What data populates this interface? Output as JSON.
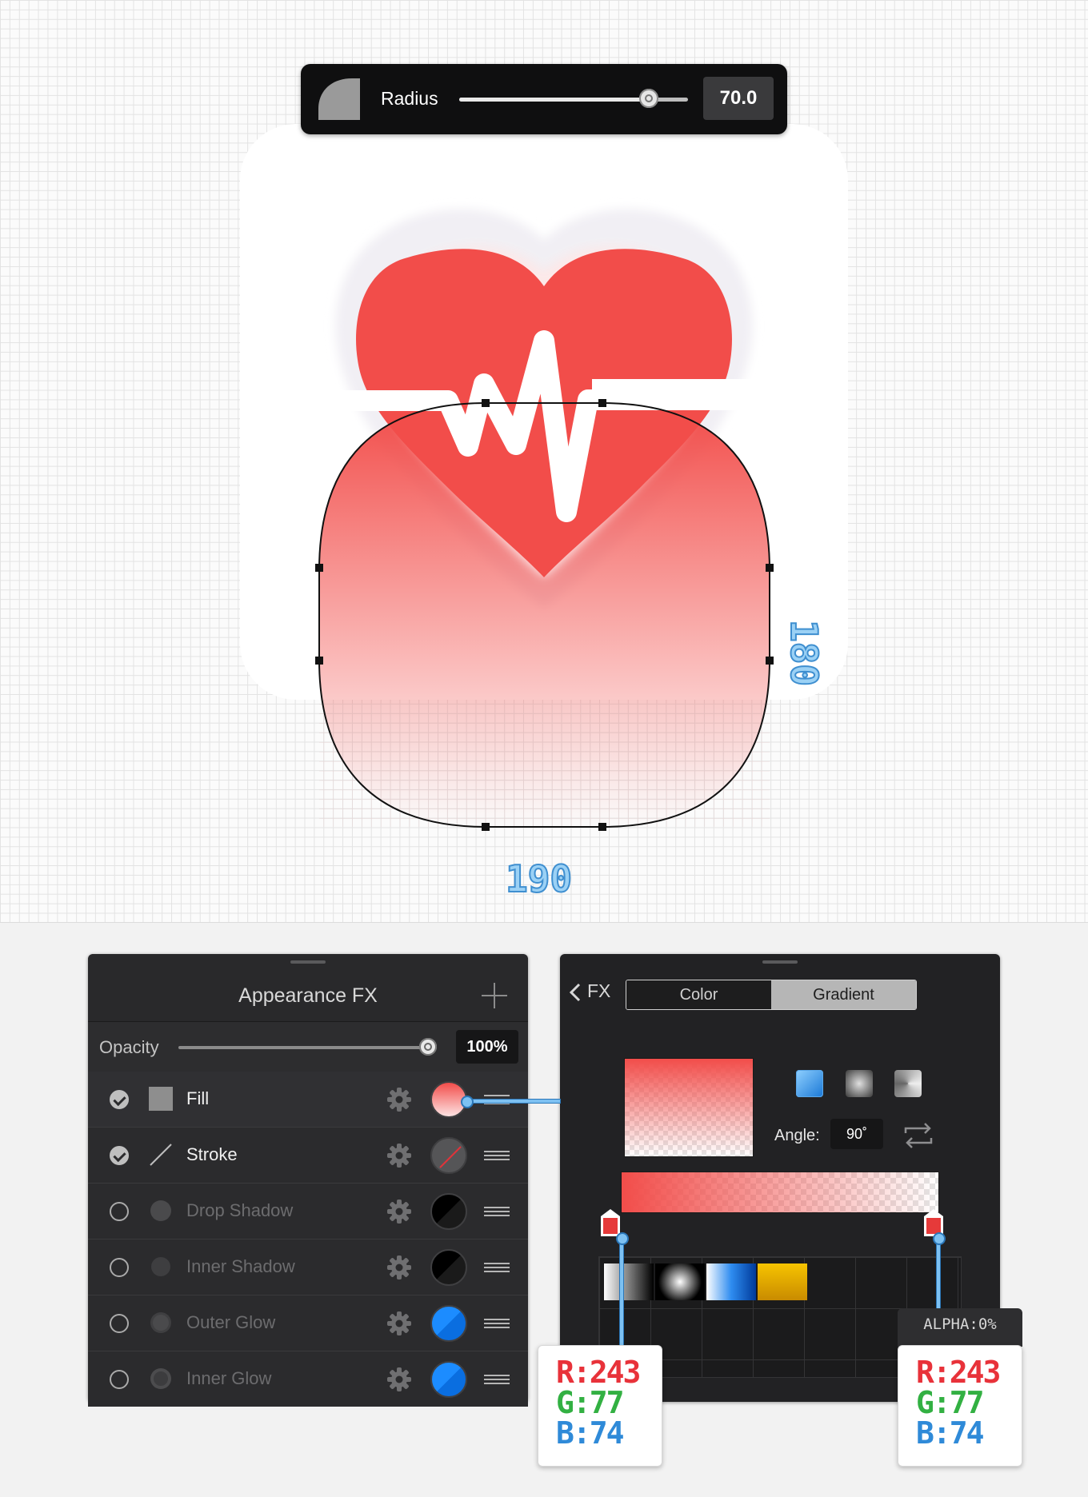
{
  "toolbar": {
    "radius_label": "Radius",
    "radius_value": "70.0",
    "radius_fraction": 0.83
  },
  "dimensions": {
    "width": "190",
    "height": "180"
  },
  "appearance": {
    "title": "Appearance FX",
    "opacity_label": "Opacity",
    "opacity_value": "100%",
    "opacity_fraction": 1.0,
    "effects": [
      {
        "label": "Fill",
        "enabled": true,
        "swatch": "gradient"
      },
      {
        "label": "Stroke",
        "enabled": true,
        "swatch": "none"
      },
      {
        "label": "Drop Shadow",
        "enabled": false,
        "swatch": "#000000"
      },
      {
        "label": "Inner Shadow",
        "enabled": false,
        "swatch": "#000000"
      },
      {
        "label": "Outer Glow",
        "enabled": false,
        "swatch": "#0a84ff"
      },
      {
        "label": "Inner Glow",
        "enabled": false,
        "swatch": "#0a84ff"
      }
    ]
  },
  "gradient_panel": {
    "back_label": "FX",
    "tabs": [
      "Color",
      "Gradient"
    ],
    "active_tab": "Gradient",
    "angle_label": "Angle:",
    "angle_value": "90˚",
    "types": [
      "linear",
      "radial",
      "angle"
    ]
  },
  "stops": {
    "alpha_tag": "ALPHA:0%",
    "left": {
      "r": "R:243",
      "g": "G:77",
      "b": "B:74"
    },
    "right": {
      "r": "R:243",
      "g": "G:77",
      "b": "B:74"
    }
  },
  "colors": {
    "heart": "#f24d4a",
    "accent": "#0a84ff",
    "dimension": "#3f8fd0"
  }
}
